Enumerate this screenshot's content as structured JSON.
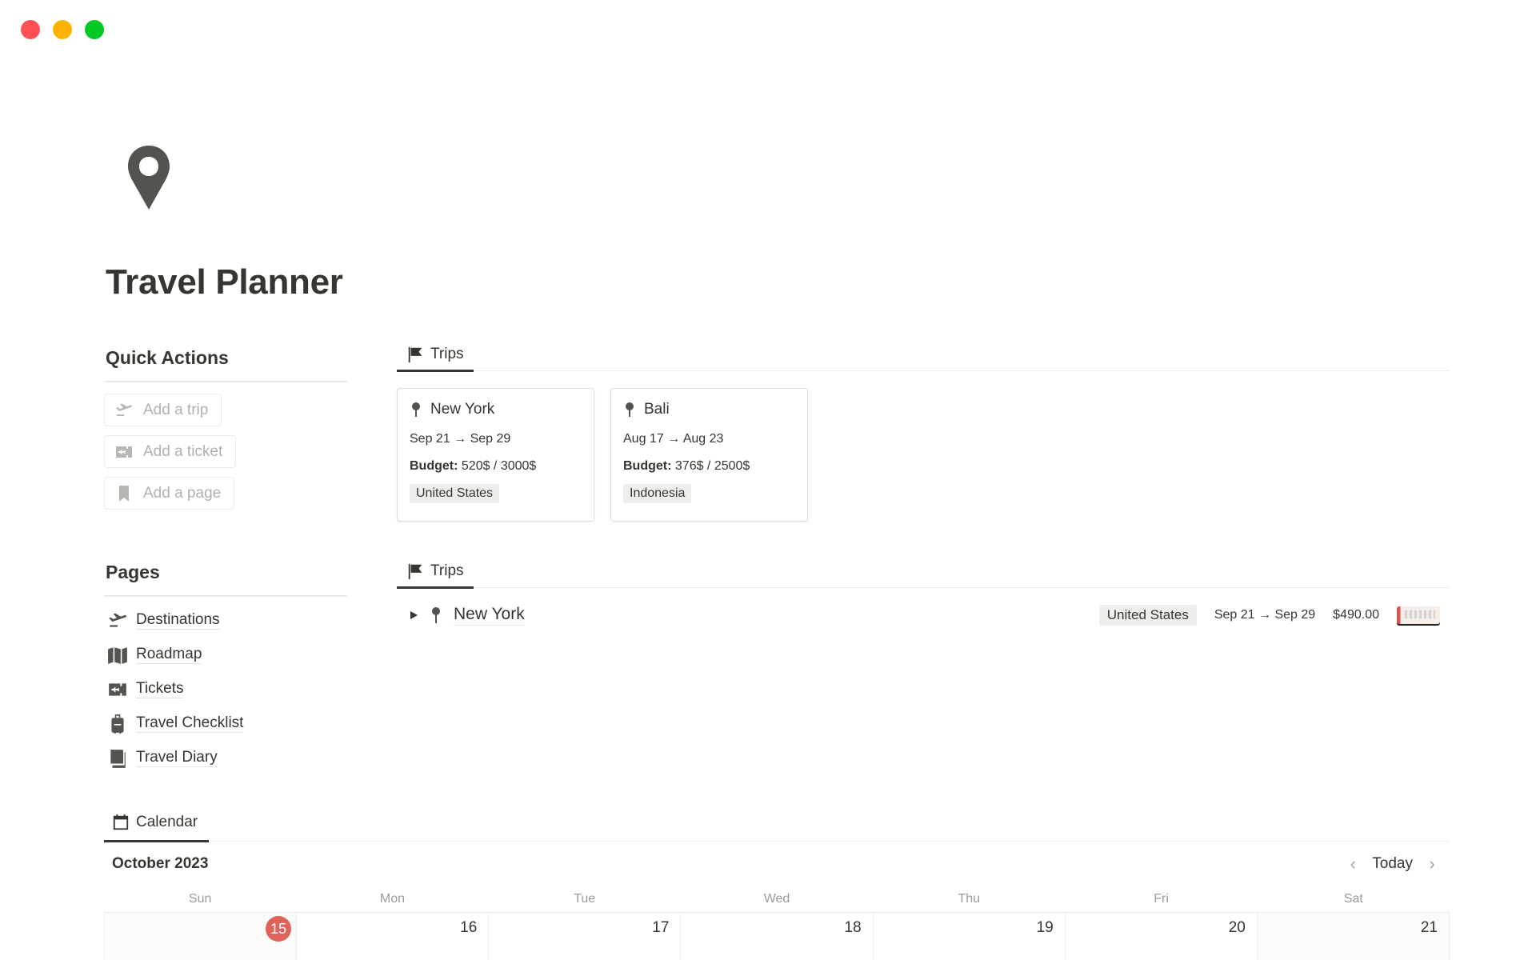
{
  "window": {
    "traffic_lights": {
      "close": "#fe4f54",
      "minimize": "#feb302",
      "zoom": "#02c923"
    }
  },
  "page": {
    "icon": "map-pin-icon",
    "title": "Travel Planner"
  },
  "quick_actions": {
    "heading": "Quick Actions",
    "buttons": [
      {
        "label": "Add a trip",
        "icon": "airplane-departure-icon"
      },
      {
        "label": "Add a ticket",
        "icon": "ticket-icon"
      },
      {
        "label": "Add a page",
        "icon": "bookmark-icon"
      }
    ]
  },
  "pages": {
    "heading": "Pages",
    "items": [
      {
        "label": "Destinations",
        "icon": "airplane-departure-icon"
      },
      {
        "label": "Roadmap",
        "icon": "map-icon"
      },
      {
        "label": "Tickets",
        "icon": "ticket-icon"
      },
      {
        "label": "Travel Checklist",
        "icon": "luggage-icon"
      },
      {
        "label": "Travel Diary",
        "icon": "book-icon"
      }
    ]
  },
  "trips_gallery": {
    "tab_label": "Trips",
    "tab_icon": "flag-icon",
    "cards": [
      {
        "title": "New York",
        "dates": "Sep 21 → Sep 29",
        "budget_label": "Budget:",
        "budget_value": "520$ / 3000$",
        "country": "United States"
      },
      {
        "title": "Bali",
        "dates": "Aug 17 → Aug 23",
        "budget_label": "Budget:",
        "budget_value": "376$ / 2500$",
        "country": "Indonesia"
      }
    ]
  },
  "trips_list": {
    "tab_label": "Trips",
    "tab_icon": "flag-icon",
    "rows": [
      {
        "title": "New York",
        "country": "United States",
        "dates": "Sep 21 → Sep 29",
        "cost": "$490.00",
        "thumbnail": "ticket-image"
      }
    ]
  },
  "calendar": {
    "tab_label": "Calendar",
    "tab_icon": "calendar-icon",
    "month": "October 2023",
    "today_label": "Today",
    "prev_label": "‹",
    "next_label": "›",
    "accent_today": "#e16259",
    "day_names": [
      "Sun",
      "Mon",
      "Tue",
      "Wed",
      "Thu",
      "Fri",
      "Sat"
    ],
    "days": [
      {
        "num": "15",
        "today": true,
        "weekend": true
      },
      {
        "num": "16",
        "today": false,
        "weekend": false
      },
      {
        "num": "17",
        "today": false,
        "weekend": false
      },
      {
        "num": "18",
        "today": false,
        "weekend": false
      },
      {
        "num": "19",
        "today": false,
        "weekend": false
      },
      {
        "num": "20",
        "today": false,
        "weekend": false
      },
      {
        "num": "21",
        "today": false,
        "weekend": true
      }
    ]
  }
}
